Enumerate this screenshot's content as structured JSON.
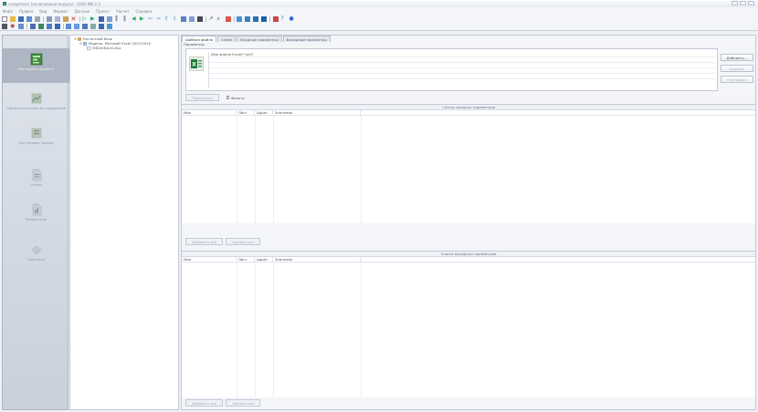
{
  "titlebar": {
    "title": "compressor (не активный модуль) - IOSO NM 2.3"
  },
  "menubar": {
    "items": [
      "Файл",
      "Правка",
      "Вид",
      "Формат",
      "Данные",
      "Проект",
      "Расчет",
      "Справка"
    ]
  },
  "nav": {
    "items": [
      {
        "label": "Настройка проекта",
        "active": true
      },
      {
        "label": "Параметрическое исследование",
        "active": false
      },
      {
        "label": "Постановка задачи",
        "active": false
      },
      {
        "label": "Стены",
        "active": false
      },
      {
        "label": "Результаты",
        "active": false
      },
      {
        "label": "Протокол",
        "active": false
      }
    ]
  },
  "tree": {
    "items": [
      {
        "label": "Расчетный блок",
        "level": 0
      },
      {
        "label": "Модель: Microsoft Excel 2007/2010",
        "level": 1
      },
      {
        "label": "IOSOmExcel.xlsx",
        "level": 2
      }
    ]
  },
  "tabs": [
    "Шаблон файла",
    "Схема",
    "Входные параметры",
    "Выходные параметры"
  ],
  "panel": {
    "title": "Параметры",
    "file_list_header": "Имя файла Excel(*.xls*)",
    "add_button": "Добавить...",
    "delete_button": "Удалить",
    "settings_button": "Настройка",
    "params_button": "Параметры",
    "filter_label": "Фильтр"
  },
  "inputs": {
    "title": "Список входных параметров",
    "columns": [
      "Имя",
      "Лист",
      "Адрес",
      "Значение"
    ],
    "add_all": "Добавить все",
    "delete_all": "Удалить все"
  },
  "outputs": {
    "title": "Список выходных параметров",
    "columns": [
      "Имя",
      "Лист",
      "Адрес",
      "Значение"
    ],
    "add_all": "Добавить все",
    "delete_all": "Удалить все"
  }
}
